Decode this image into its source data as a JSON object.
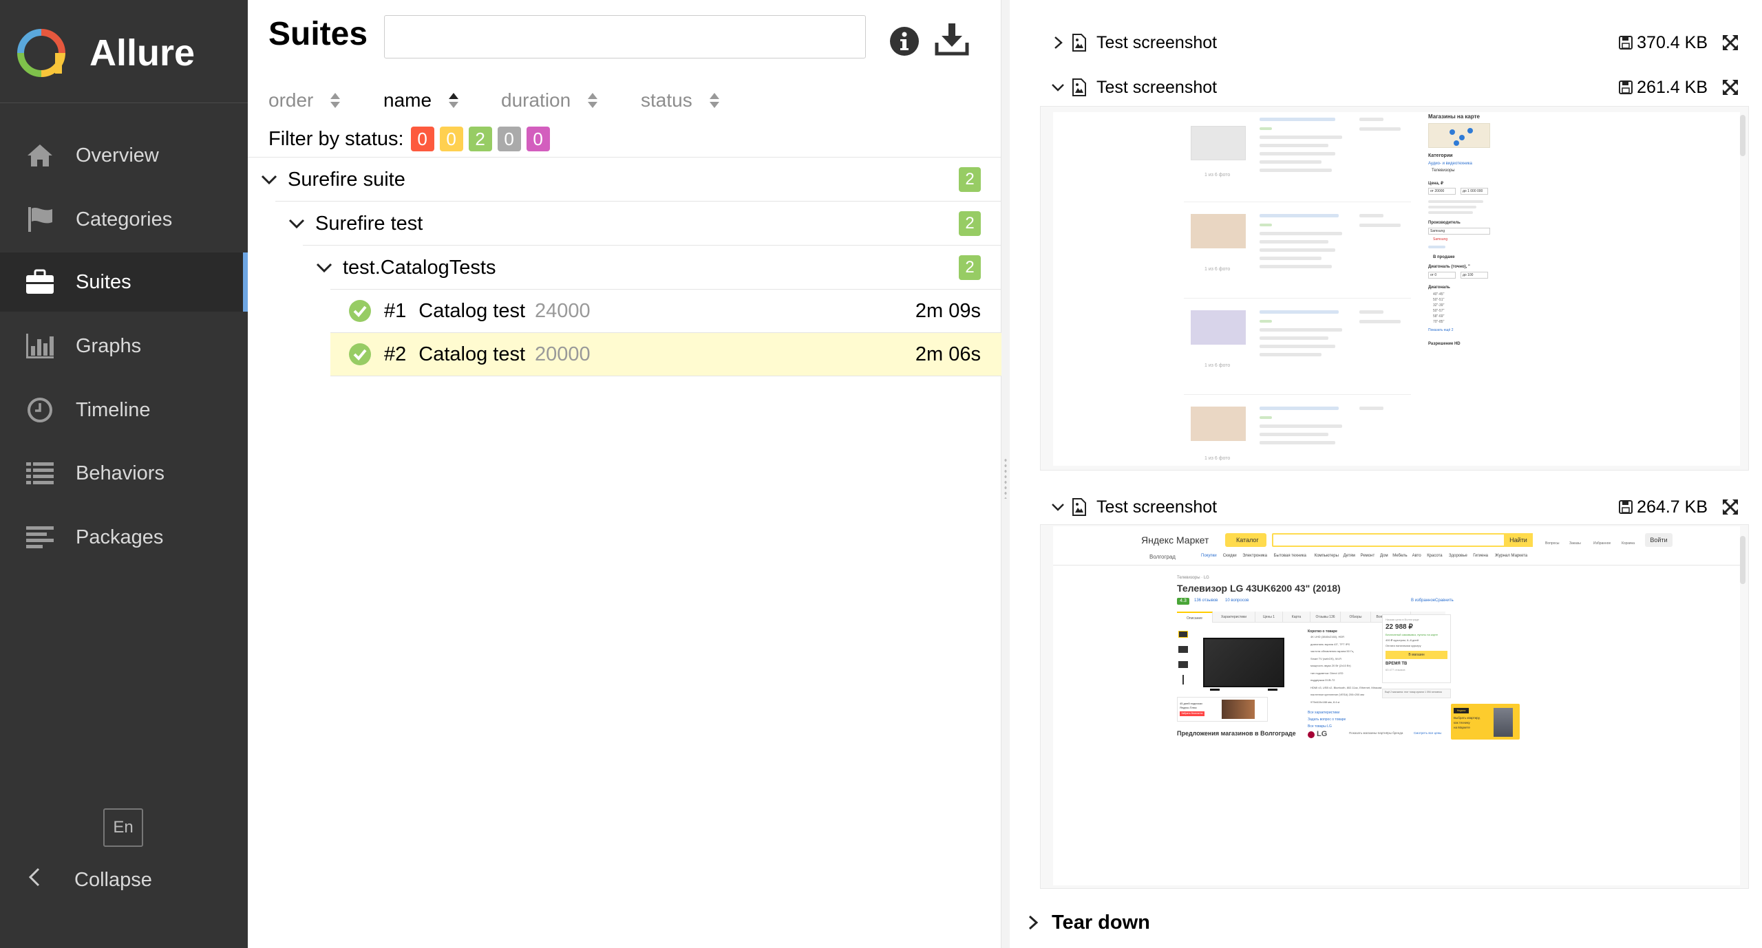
{
  "app": {
    "name": "Allure"
  },
  "sidebar": {
    "items": [
      {
        "label": "Overview",
        "icon": "home-icon"
      },
      {
        "label": "Categories",
        "icon": "flag-icon"
      },
      {
        "label": "Suites",
        "icon": "briefcase-icon",
        "active": true
      },
      {
        "label": "Graphs",
        "icon": "bar-chart-icon"
      },
      {
        "label": "Timeline",
        "icon": "clock-icon"
      },
      {
        "label": "Behaviors",
        "icon": "list-icon"
      },
      {
        "label": "Packages",
        "icon": "align-left-icon"
      }
    ],
    "language": "En",
    "collapse_label": "Collapse"
  },
  "suites": {
    "title": "Suites",
    "search_value": "",
    "sort": {
      "order": "order",
      "name": "name",
      "duration": "duration",
      "status": "status"
    },
    "filter_label": "Filter by status:",
    "status_counts": [
      {
        "status": "failed",
        "count": "0",
        "color": "#fd5a3e"
      },
      {
        "status": "broken",
        "count": "0",
        "color": "#ffd050"
      },
      {
        "status": "passed",
        "count": "2",
        "color": "#97cc64"
      },
      {
        "status": "skipped",
        "count": "0",
        "color": "#aaaaaa"
      },
      {
        "status": "unknown",
        "count": "0",
        "color": "#d35ebe"
      }
    ],
    "tree": [
      {
        "label": "Surefire suite",
        "count": "2"
      },
      {
        "label": "Surefire test",
        "count": "2"
      },
      {
        "label": "test.CatalogTests",
        "count": "2"
      }
    ],
    "cases": [
      {
        "num": "#1",
        "name": "Catalog test",
        "param": "24000",
        "duration": "2m 09s",
        "selected": false
      },
      {
        "num": "#2",
        "name": "Catalog test",
        "param": "20000",
        "duration": "2m 06s",
        "selected": true
      }
    ]
  },
  "attachments": [
    {
      "title": "Test screenshot",
      "size": "370.4 KB",
      "expanded": false
    },
    {
      "title": "Test screenshot",
      "size": "261.4 KB",
      "expanded": true
    },
    {
      "title": "Test screenshot",
      "size": "264.7 KB",
      "expanded": true
    }
  ],
  "shot1": {
    "map_title": "Магазины на карте",
    "categories_title": "Категории",
    "category_link": "Аудио- и видеотехника",
    "category_item": "Телевизоры",
    "price_title": "Цена, ₽",
    "price_from": "от 20000",
    "price_to": "до 1 000 000",
    "manufacturer_title": "Производитель",
    "manufacturer_value": "Samsung",
    "on_sale": "В продаже",
    "diagonal_title": "Диагональ (точно), \"",
    "diag_from": "от 0",
    "diag_to": "до 100",
    "diag_list_title": "Диагональ",
    "diag_options": [
      "40\"-45\"",
      "50\"-51\"",
      "32\"-39\"",
      "50\"-57\"",
      "58\"-69\"",
      "70\"-85\""
    ],
    "show_more": "Показать ещё 2",
    "resolution_title": "Разрешение HD",
    "photo_caption": "1 из 6 фото"
  },
  "shot2": {
    "market_name": "Яндекс Маркет",
    "catalog_btn": "Каталог",
    "find_btn": "Найти",
    "login_btn": "Войти",
    "header_icons": [
      "Вопросы",
      "Заказы",
      "Избранное",
      "Корзина"
    ],
    "city": "Волгоград",
    "nav": [
      "Покупки",
      "Скидки",
      "Электроника",
      "Бытовая техника",
      "Компьютеры",
      "Детям",
      "Ремонт",
      "Дом",
      "Мебель",
      "Авто",
      "Красота",
      "Здоровье",
      "Гигиена",
      "Журнал Маркета"
    ],
    "breadcrumb": "Телевизоры · LG",
    "product_title": "Телевизор LG 43UK6200 43\" (2018)",
    "rating": "4.3",
    "reviews": "136 отзывов",
    "questions": "10 вопросов",
    "fav": "В избранное",
    "compare": "Сравнить",
    "tabs": [
      "Описание",
      "Характеристики",
      "Цены 1",
      "Карта",
      "Отзывы 136",
      "Обзоры",
      "Вопросы о товаре"
    ],
    "brief_title": "Коротко о товаре",
    "brief": [
      "4K UHD (3840x2160), HDR",
      "диагональ экрана 43\", TFT IPS",
      "частота обновления экрана 50 Гц",
      "Smart TV (webOS), Wi-Fi",
      "мощность звука 20 Вт (2x10 Вт)",
      "тип подсветки: Direct LED",
      "поддержка DVB-T2",
      "HDMI x3, USB x2, Bluetooth, 802.11ac, Ethernet, Miracast",
      "настенное крепление (VESA) 200×200 мм",
      "975x615x188 мм, 8.4 кг"
    ],
    "all_specs": "Все характеристики",
    "ask": "Задать вопрос о товаре",
    "all_lg": "Все товары LG",
    "brand": "LG",
    "price_label": "Низкая цена в Волгограде",
    "price": "22 988 ₽",
    "pickup": "Бесплатный самовывоз, пункты на карте",
    "delivery": "400 ₽ курьером, 6–8 дней",
    "pay": "Оплата наличными курьеру",
    "to_store": "В магазин",
    "store": "ВРЕМЯ ТВ",
    "store_reviews": "63 477 отзывов",
    "more_stores": "Ещё 2 магазина: этот товар купили 1 094 человека",
    "promo_lines": [
      "45 дней подписки",
      "Яндекс.Плюс"
    ],
    "promo_btn": "Забрать бесплатно",
    "offers_title": "Предложения магазинов в Волгограде",
    "show_partners": "Показать магазины-партнёры бренда",
    "see_all": "Смотреть все цены",
    "ad_lines": [
      "Выбрать квартиру,",
      "как технику",
      "на Маркете"
    ],
    "ad_brand": "Недвиж"
  },
  "teardown": {
    "label": "Tear down"
  }
}
